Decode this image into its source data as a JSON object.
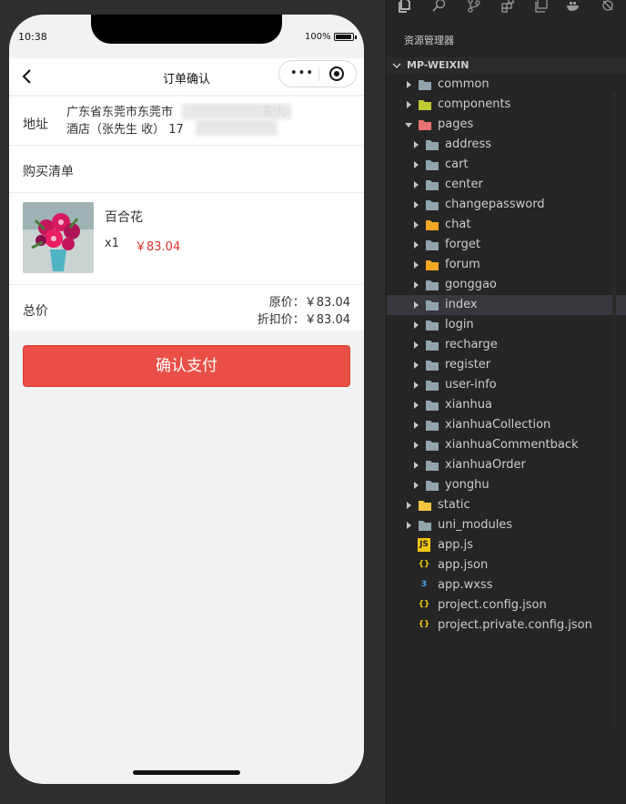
{
  "status_bar": {
    "time": "10:38",
    "battery": "100%"
  },
  "navbar": {
    "title": "订单确认",
    "more": "•••"
  },
  "address": {
    "label": "地址",
    "text": "广东省东莞市东莞市",
    "text_line1_tail": "东大",
    "text_line2": "酒店（张先生 收） 17"
  },
  "purchase_list": {
    "title": "购买清单"
  },
  "goods": {
    "name": "百合花",
    "qty": "x1",
    "price": "￥83.04"
  },
  "totals": {
    "label": "总价",
    "original_label": "原价：",
    "original_value": "￥83.04",
    "discount_label": "折扣价：",
    "discount_value": "￥83.04"
  },
  "pay_button": {
    "label": "确认支付"
  },
  "explorer": {
    "title": "资源管理器",
    "project": "MP-WEIXIN",
    "items": [
      {
        "label": "common",
        "depth": 1,
        "kind": "folder",
        "color": "#90a4ae",
        "expanded": false
      },
      {
        "label": "components",
        "depth": 1,
        "kind": "folder",
        "color": "#c0ca33",
        "expanded": false
      },
      {
        "label": "pages",
        "depth": 1,
        "kind": "folder",
        "color": "#e57373",
        "expanded": true
      },
      {
        "label": "address",
        "depth": 2,
        "kind": "folder",
        "color": "#90a4ae",
        "expanded": false
      },
      {
        "label": "cart",
        "depth": 2,
        "kind": "folder",
        "color": "#90a4ae",
        "expanded": false
      },
      {
        "label": "center",
        "depth": 2,
        "kind": "folder",
        "color": "#90a4ae",
        "expanded": false
      },
      {
        "label": "changepassword",
        "depth": 2,
        "kind": "folder",
        "color": "#90a4ae",
        "expanded": false
      },
      {
        "label": "chat",
        "depth": 2,
        "kind": "folder",
        "color": "#f5a623",
        "expanded": false
      },
      {
        "label": "forget",
        "depth": 2,
        "kind": "folder",
        "color": "#90a4ae",
        "expanded": false
      },
      {
        "label": "forum",
        "depth": 2,
        "kind": "folder",
        "color": "#f5a623",
        "expanded": false
      },
      {
        "label": "gonggao",
        "depth": 2,
        "kind": "folder",
        "color": "#90a4ae",
        "expanded": false
      },
      {
        "label": "index",
        "depth": 2,
        "kind": "folder",
        "color": "#90a4ae",
        "expanded": false,
        "selected": true
      },
      {
        "label": "login",
        "depth": 2,
        "kind": "folder",
        "color": "#90a4ae",
        "expanded": false
      },
      {
        "label": "recharge",
        "depth": 2,
        "kind": "folder",
        "color": "#90a4ae",
        "expanded": false
      },
      {
        "label": "register",
        "depth": 2,
        "kind": "folder",
        "color": "#90a4ae",
        "expanded": false
      },
      {
        "label": "user-info",
        "depth": 2,
        "kind": "folder",
        "color": "#90a4ae",
        "expanded": false
      },
      {
        "label": "xianhua",
        "depth": 2,
        "kind": "folder",
        "color": "#90a4ae",
        "expanded": false
      },
      {
        "label": "xianhuaCollection",
        "depth": 2,
        "kind": "folder",
        "color": "#90a4ae",
        "expanded": false
      },
      {
        "label": "xianhuaCommentback",
        "depth": 2,
        "kind": "folder",
        "color": "#90a4ae",
        "expanded": false
      },
      {
        "label": "xianhuaOrder",
        "depth": 2,
        "kind": "folder",
        "color": "#90a4ae",
        "expanded": false
      },
      {
        "label": "yonghu",
        "depth": 2,
        "kind": "folder",
        "color": "#90a4ae",
        "expanded": false
      },
      {
        "label": "static",
        "depth": 1,
        "kind": "folder",
        "color": "#f5c542",
        "expanded": false
      },
      {
        "label": "uni_modules",
        "depth": 1,
        "kind": "folder",
        "color": "#90a4ae",
        "expanded": false
      },
      {
        "label": "app.js",
        "depth": 1,
        "kind": "js",
        "color": "#f1c40f"
      },
      {
        "label": "app.json",
        "depth": 1,
        "kind": "json",
        "color": "#f1c40f"
      },
      {
        "label": "app.wxss",
        "depth": 1,
        "kind": "css",
        "color": "#42a5f5"
      },
      {
        "label": "project.config.json",
        "depth": 1,
        "kind": "json",
        "color": "#f1c40f"
      },
      {
        "label": "project.private.config.json",
        "depth": 1,
        "kind": "json",
        "color": "#f1c40f"
      }
    ]
  },
  "icons": {
    "back": "chevron-left-icon",
    "target": "record-icon",
    "files": "files-icon",
    "search": "search-icon",
    "git": "source-control-icon",
    "extensions": "extensions-icon"
  }
}
